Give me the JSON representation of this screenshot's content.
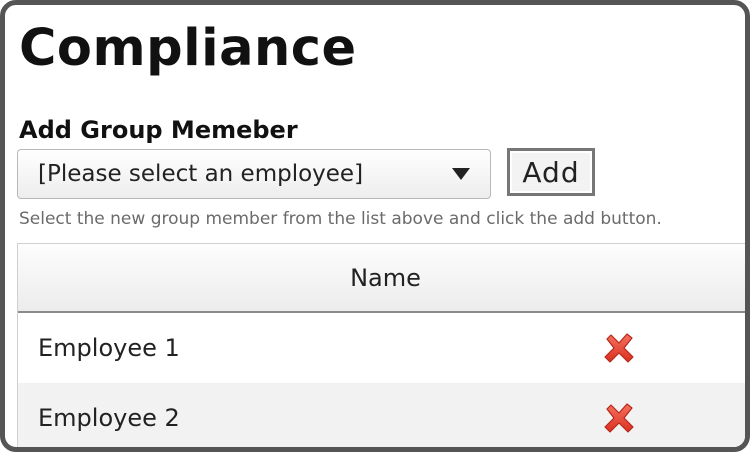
{
  "page": {
    "title": "Compliance"
  },
  "add_member": {
    "label": "Add Group Memeber",
    "select_value": "[Please select an employee]",
    "add_button_label": "Add",
    "hint": "Select the new group member from the list above and click the add button."
  },
  "members_table": {
    "header_name": "Name",
    "rows": [
      {
        "name": "Employee 1",
        "action_icon": "remove-x-icon"
      },
      {
        "name": "Employee 2",
        "action_icon": "remove-x-icon"
      }
    ]
  },
  "colors": {
    "frame_border": "#555555",
    "remove_icon": "#e8453c",
    "alt_row": "#f2f2f2"
  }
}
